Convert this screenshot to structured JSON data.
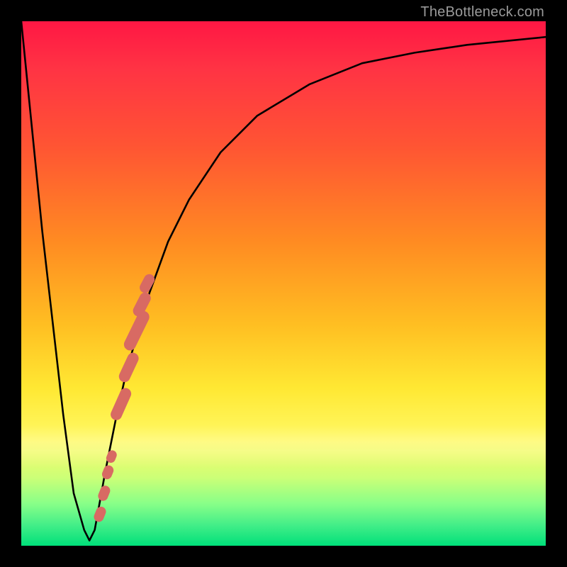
{
  "watermark": "TheBottleneck.com",
  "chart_data": {
    "type": "line",
    "title": "",
    "xlabel": "",
    "ylabel": "",
    "xlim": [
      0,
      100
    ],
    "ylim": [
      0,
      100
    ],
    "grid": false,
    "series": [
      {
        "name": "bottleneck-curve",
        "x": [
          0,
          4,
          8,
          10,
          12,
          13,
          14,
          16,
          18,
          20,
          24,
          28,
          32,
          38,
          45,
          55,
          65,
          75,
          85,
          95,
          100
        ],
        "y": [
          100,
          60,
          25,
          10,
          3,
          1,
          3,
          14,
          24,
          33,
          47,
          58,
          66,
          75,
          82,
          88,
          92,
          94,
          95.5,
          96.5,
          97
        ]
      }
    ],
    "markers": {
      "name": "highlight-segment",
      "color": "#d86a63",
      "points": [
        {
          "x": 15.0,
          "y": 6
        },
        {
          "x": 15.8,
          "y": 10
        },
        {
          "x": 16.5,
          "y": 14
        },
        {
          "x": 17.2,
          "y": 17
        },
        {
          "x": 19.0,
          "y": 27
        },
        {
          "x": 20.5,
          "y": 34
        },
        {
          "x": 22.0,
          "y": 41
        },
        {
          "x": 23.0,
          "y": 46
        },
        {
          "x": 24.0,
          "y": 50
        }
      ]
    }
  }
}
